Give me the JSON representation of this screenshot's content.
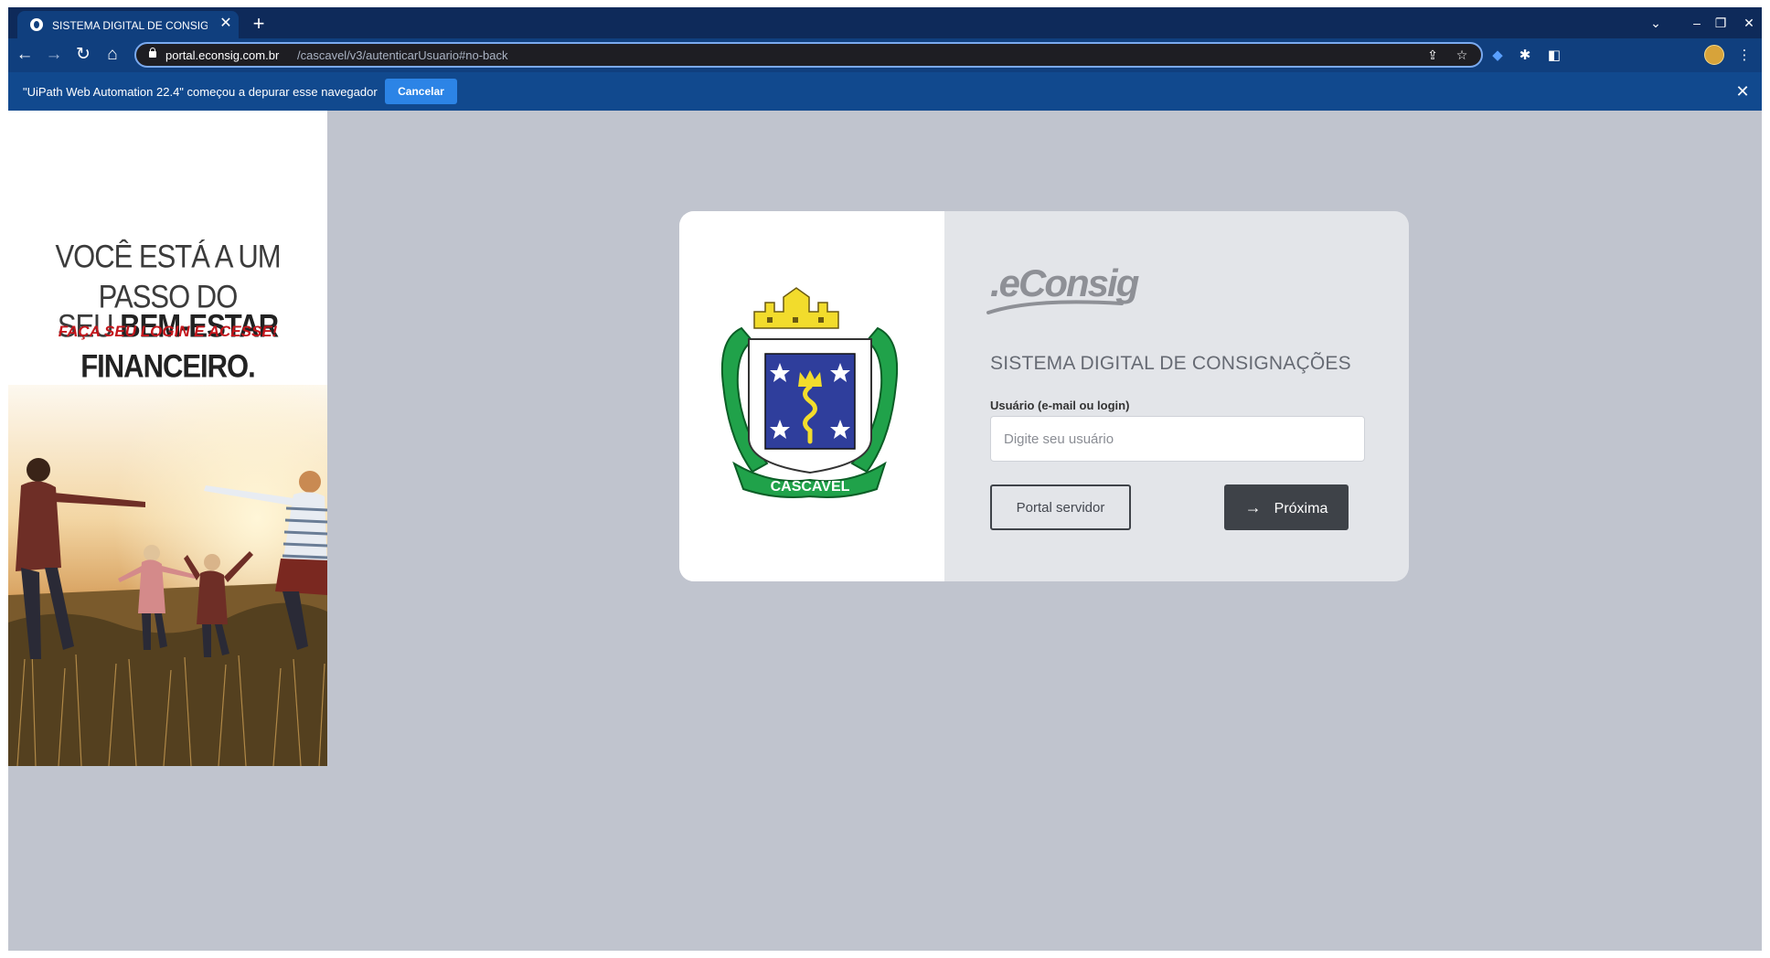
{
  "browser": {
    "tab_title": "SISTEMA DIGITAL DE CONSIGNAÇÕES",
    "tab_close": "✕",
    "new_tab": "+",
    "url_host": "portal.econsig.com.br",
    "url_path": "/cascavel/v3/autenticarUsuario#no-back",
    "window_controls": {
      "tab_search": "⌄",
      "minimize": "–",
      "restore": "❐",
      "close": "✕"
    }
  },
  "infobar": {
    "message": "\"UiPath Web Automation 22.4\" começou a depurar esse navegador",
    "cancel_label": "Cancelar",
    "close": "✕"
  },
  "promo": {
    "line1": "VOCÊ ESTÁ A UM PASSO DO",
    "line2_prefix": "SEU ",
    "line2_bold": "BEM-ESTAR FINANCEIRO.",
    "cta": "FAÇA SEU LOGIN E ACESSE!"
  },
  "login": {
    "crest_label": "CASCAVEL",
    "brand": ".eConsig",
    "system_title": "SISTEMA DIGITAL DE CONSIGNAÇÕES",
    "user_label": "Usuário (e-mail ou login)",
    "user_placeholder": "Digite seu usuário",
    "portal_button": "Portal servidor",
    "next_button": "Próxima"
  },
  "colors": {
    "chrome_dark": "#0e2a5a",
    "chrome_toolbar": "#103f7e",
    "infobar": "#11498e",
    "cancel_button": "#2c84e6",
    "page_background": "#c0c4ce",
    "form_panel": "#e3e5e9",
    "primary_button": "#3e4248",
    "promo_cta": "#c4161c"
  }
}
